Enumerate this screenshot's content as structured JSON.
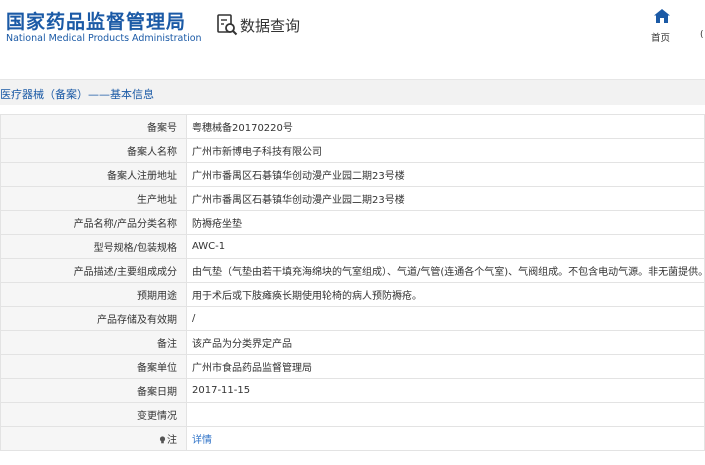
{
  "header": {
    "logo_cn": "国家药品监督管理局",
    "logo_en": "National Medical Products Administration",
    "data_query": "数据查询",
    "home_label": "首页",
    "right_mark": "("
  },
  "breadcrumb": "医疗器械（备案）——基本信息",
  "rows": [
    {
      "key": "备案号",
      "value": "粤穗械备20170220号"
    },
    {
      "key": "备案人名称",
      "value": "广州市新博电子科技有限公司"
    },
    {
      "key": "备案人注册地址",
      "value": "广州市番禺区石碁镇华创动漫产业园二期23号楼"
    },
    {
      "key": "生产地址",
      "value": "广州市番禺区石碁镇华创动漫产业园二期23号楼"
    },
    {
      "key": "产品名称/产品分类名称",
      "value": "防褥疮坐垫"
    },
    {
      "key": "型号规格/包装规格",
      "value": "AWC-1"
    },
    {
      "key": "产品描述/主要组成成分",
      "value": "由气垫（气垫由若干填充海绵块的气室组成）、气道/气管(连通各个气室)、气阀组成。不包含电动气源。非无菌提供。"
    },
    {
      "key": "预期用途",
      "value": "用于术后或下肢瘫痪长期使用轮椅的病人预防褥疮。"
    },
    {
      "key": "产品存储及有效期",
      "value": "/"
    },
    {
      "key": "备注",
      "value": "该产品为分类界定产品"
    },
    {
      "key": "备案单位",
      "value": "广州市食品药品监督管理局"
    },
    {
      "key": "备案日期",
      "value": "2017-11-15"
    },
    {
      "key": "变更情况",
      "value": ""
    },
    {
      "key": "注",
      "value": "详情"
    }
  ],
  "colors": {
    "brand": "#1b5aa6",
    "link": "#2f73c8",
    "label_bg": "#f6f6f6",
    "border": "#e3e3e3"
  },
  "icons": [
    "search-icon",
    "home-icon",
    "lightbulb-icon"
  ]
}
